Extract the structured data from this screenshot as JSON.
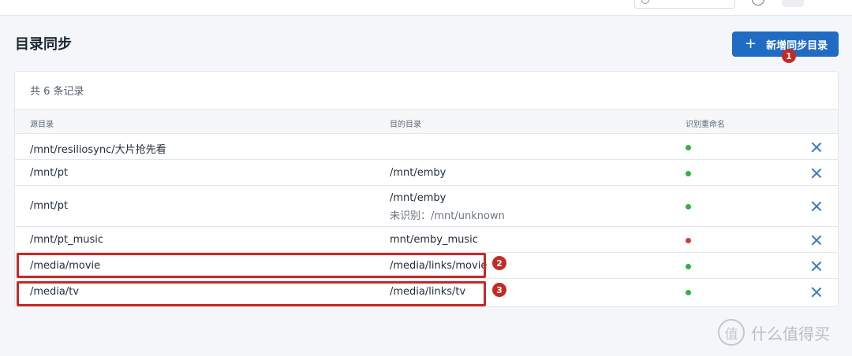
{
  "page": {
    "title": "目录同步"
  },
  "actions": {
    "add_label": "新增同步目录",
    "add_icon": "plus-icon"
  },
  "card": {
    "count_text": "共 6 条记录"
  },
  "table": {
    "columns": [
      "源目录",
      "目的目录",
      "识别重命名"
    ],
    "rows": [
      {
        "source": "/mnt/resiliosync/大片抢先看",
        "target": "",
        "unrecognized": "",
        "rename": "green"
      },
      {
        "source": "/mnt/pt",
        "target": "/mnt/emby",
        "unrecognized": "",
        "rename": "green"
      },
      {
        "source": "/mnt/pt",
        "target": "/mnt/emby",
        "unrecognized": "未识别：/mnt/unknown",
        "rename": "green"
      },
      {
        "source": "/mnt/pt_music",
        "target": "mnt/emby_music",
        "unrecognized": "",
        "rename": "red"
      },
      {
        "source": "/media/movie",
        "target": "/media/links/movie",
        "unrecognized": "",
        "rename": "green"
      },
      {
        "source": "/media/tv",
        "target": "/media/links/tv",
        "unrecognized": "",
        "rename": "green"
      }
    ]
  },
  "annotations": {
    "badge1": "1",
    "badge2": "2",
    "badge3": "3"
  },
  "watermark": {
    "logo": "值",
    "text": "什么值得买"
  },
  "colors": {
    "primary": "#206bc4",
    "status_ok": "#2fb344",
    "status_off": "#d63939",
    "annotation": "#c52a26"
  }
}
